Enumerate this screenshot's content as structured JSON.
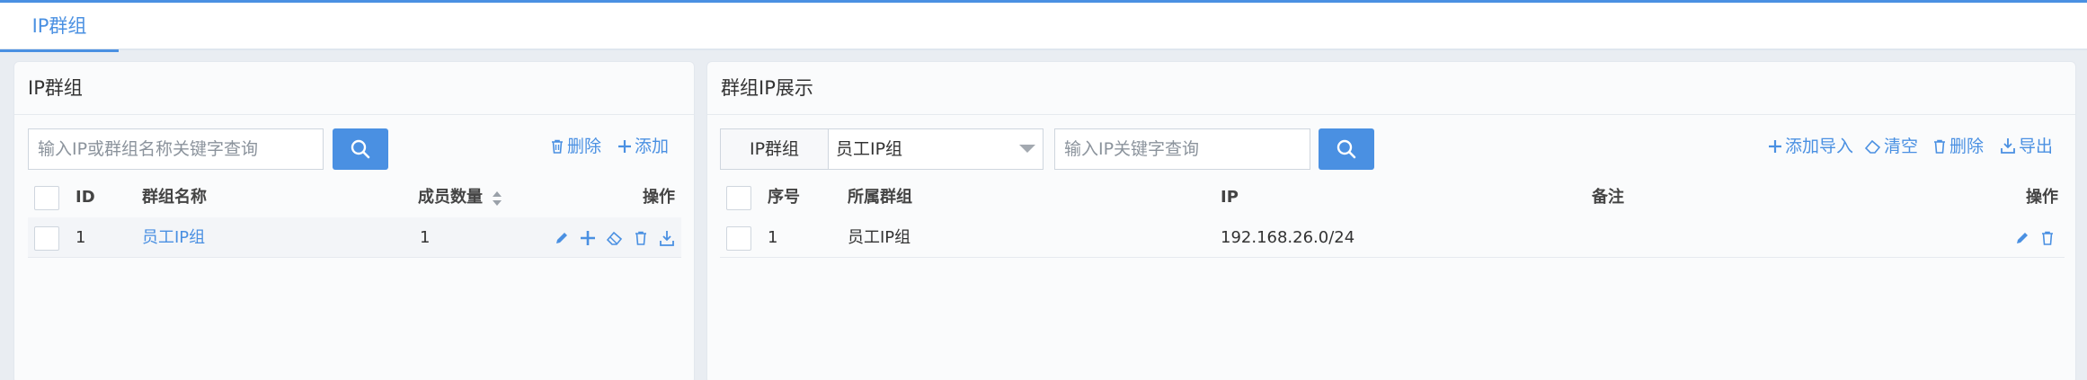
{
  "tabs": [
    {
      "label": "IP群组"
    }
  ],
  "left_panel": {
    "title": "IP群组",
    "search_placeholder": "输入IP或群组名称关键字查询",
    "delete_label": "删除",
    "add_label": "添加",
    "columns": {
      "id": "ID",
      "name": "群组名称",
      "count": "成员数量",
      "ops": "操作"
    },
    "rows": [
      {
        "id": "1",
        "name": "员工IP组",
        "count": "1"
      }
    ]
  },
  "right_panel": {
    "title": "群组IP展示",
    "select_label": "IP群组",
    "select_value": "员工IP组",
    "search_placeholder": "输入IP关键字查询",
    "add_import_label": "添加导入",
    "clear_label": "清空",
    "delete_label": "删除",
    "export_label": "导出",
    "columns": {
      "seq": "序号",
      "group": "所属群组",
      "ip": "IP",
      "note": "备注",
      "ops": "操作"
    },
    "rows": [
      {
        "seq": "1",
        "group": "员工IP组",
        "ip": "192.168.26.0/24",
        "note": ""
      }
    ]
  },
  "colors": {
    "accent": "#4a90e2",
    "panel_bg": "#fafbfc",
    "row_bg": "#f3f5f8"
  }
}
